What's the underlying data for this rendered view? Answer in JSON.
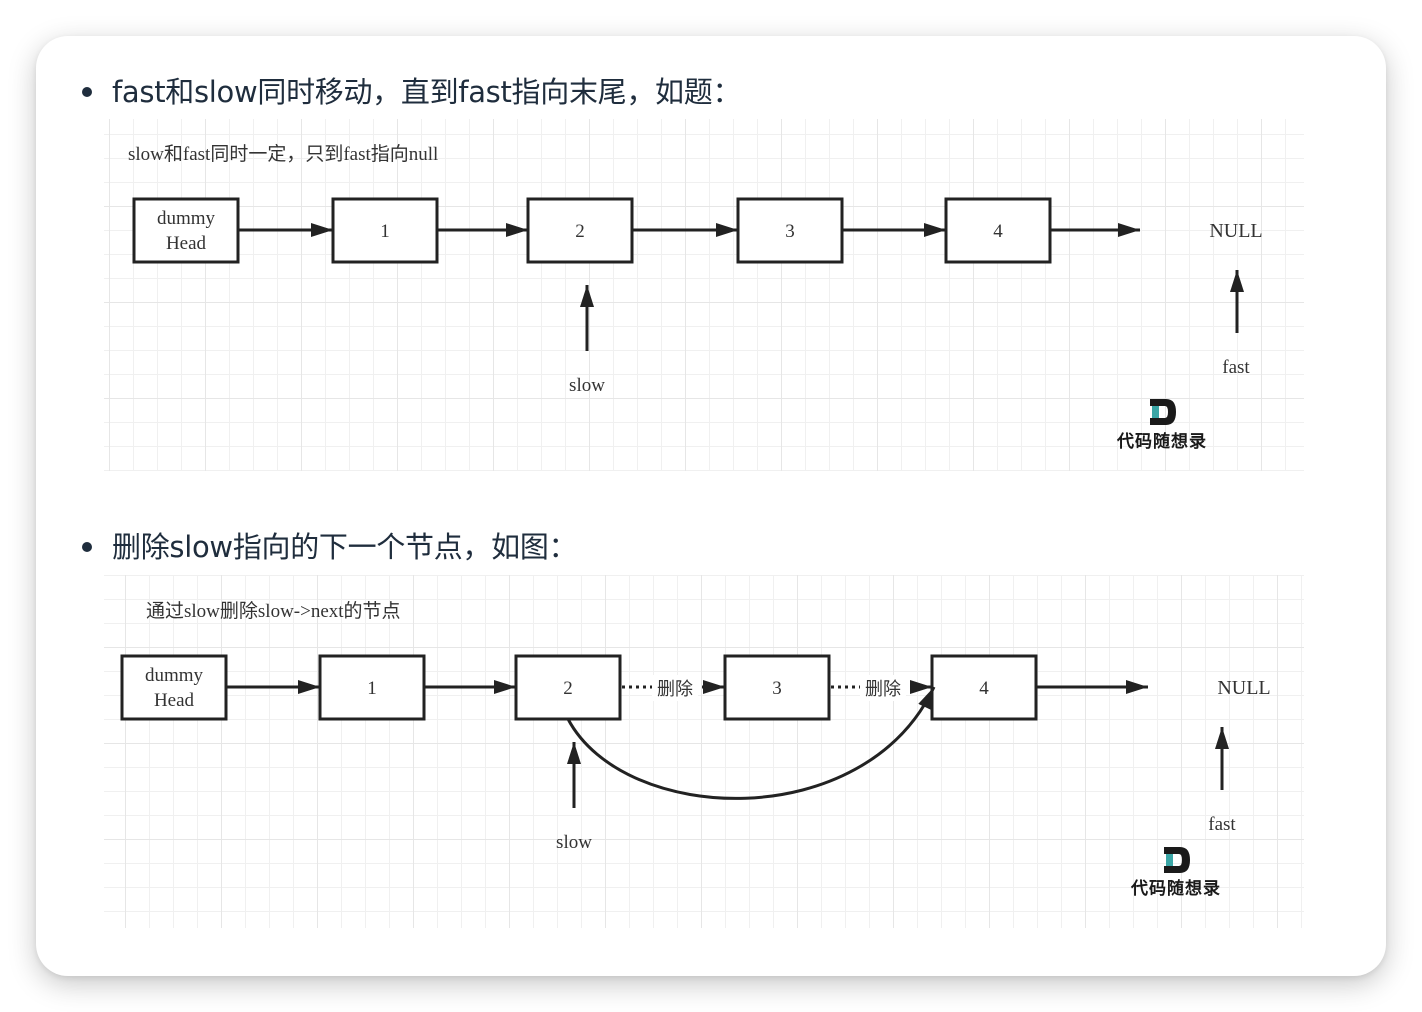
{
  "headings": [
    {
      "text": "fast和slow同时移动，直到fast指向末尾，如题："
    },
    {
      "text": "删除slow指向的下一个节点，如图："
    }
  ],
  "diagram1": {
    "caption": "slow和fast同时一定，只到fast指向null",
    "nodes": [
      {
        "line1": "dummy",
        "line2": "Head"
      },
      {
        "label": "1"
      },
      {
        "label": "2"
      },
      {
        "label": "3"
      },
      {
        "label": "4"
      }
    ],
    "null_label": "NULL",
    "slow_label": "slow",
    "fast_label": "fast",
    "slow_points_to": "2",
    "fast_points_to": "NULL"
  },
  "diagram2": {
    "caption": "通过slow删除slow->next的节点",
    "nodes": [
      {
        "line1": "dummy",
        "line2": "Head"
      },
      {
        "label": "1"
      },
      {
        "label": "2"
      },
      {
        "label": "3"
      },
      {
        "label": "4"
      }
    ],
    "delete_label_1": "删除",
    "delete_label_2": "删除",
    "null_label": "NULL",
    "slow_label": "slow",
    "fast_label": "fast",
    "slow_points_to": "2",
    "fast_points_to": "NULL"
  },
  "watermark": {
    "text": "代码随想录",
    "logo_letter": "D",
    "logo_accent_color": "#3aa6a6",
    "logo_dark_color": "#1a1a1a"
  },
  "colors": {
    "text": "#1f2d3d",
    "grid_minor": "#f0f0f0",
    "grid_major": "#e4e4e4",
    "stroke": "#222222"
  }
}
